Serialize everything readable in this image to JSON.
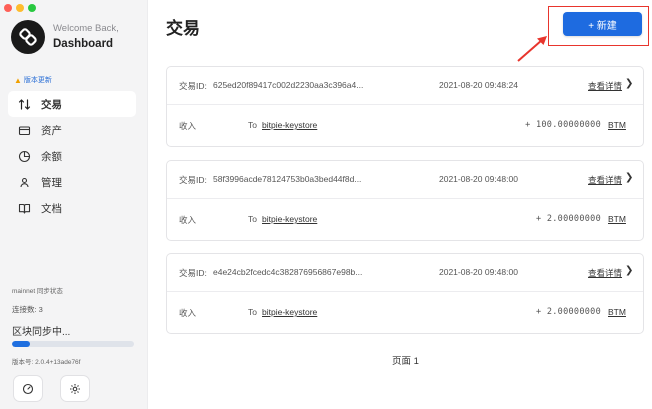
{
  "app": {
    "welcome": "Welcome Back,",
    "dashboard": "Dashboard",
    "update_badge": "版本更新"
  },
  "nav": [
    {
      "label": "交易",
      "icon": "transfer-arrows-icon",
      "active": true
    },
    {
      "label": "资产",
      "icon": "wallet-card-icon",
      "active": false
    },
    {
      "label": "余额",
      "icon": "pie-chart-icon",
      "active": false
    },
    {
      "label": "管理",
      "icon": "user-icon",
      "active": false
    },
    {
      "label": "文档",
      "icon": "book-icon",
      "active": false
    }
  ],
  "status": {
    "network": "mainnet 同步状态",
    "connections": "连接数: 3",
    "syncing": "区块同步中...",
    "sync_progress_percent": 15,
    "version": "版本号: 2.0.4+13ade76f"
  },
  "main": {
    "title": "交易",
    "new_button": "+ 新建"
  },
  "transactions": [
    {
      "id_label": "交易ID:",
      "id": "625ed20f89417c002d2230aa3c396a4...",
      "time": "2021-08-20 09:48:24",
      "detail": "查看详情",
      "type": "收入",
      "to_label": "To",
      "to": "bitpie-keystore",
      "amount": "+ 100.00000000",
      "unit": "BTM"
    },
    {
      "id_label": "交易ID:",
      "id": "58f3996acde78124753b0a3bed44f8d...",
      "time": "2021-08-20 09:48:00",
      "detail": "查看详情",
      "type": "收入",
      "to_label": "To",
      "to": "bitpie-keystore",
      "amount": "+ 2.00000000",
      "unit": "BTM"
    },
    {
      "id_label": "交易ID:",
      "id": "e4e24cb2fcedc4c382876956867e98b...",
      "time": "2021-08-20 09:48:00",
      "detail": "查看详情",
      "type": "收入",
      "to_label": "To",
      "to": "bitpie-keystore",
      "amount": "+ 2.00000000",
      "unit": "BTM"
    }
  ],
  "pager": "页面 1",
  "colors": {
    "accent": "#1e6be0",
    "highlight": "#e8352d",
    "sidebar_bg": "#f4f4f5"
  }
}
